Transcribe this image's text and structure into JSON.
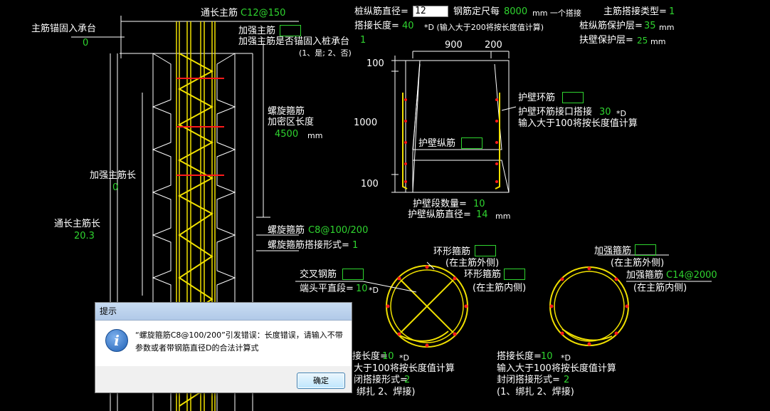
{
  "header": {
    "pile_bar_dia_label": "桩纵筋直径=",
    "pile_bar_dia_value": "12",
    "fixed_length_label": "钢筋定尺每",
    "fixed_length_value": "8000",
    "fixed_length_unit": "mm 一个搭接",
    "main_lap_type_label": "主筋搭接类型=",
    "main_lap_type_value": "1",
    "lap_length_label": "搭接长度=",
    "lap_length_value": "40",
    "lap_length_note": "*D (输入大于200将按长度值计算)",
    "pile_cover_label": "桩纵筋保护层=",
    "pile_cover_value": "35",
    "pile_cover_unit": "mm",
    "wall_cover_label": "扶壁保护层=",
    "wall_cover_value": "25",
    "wall_cover_unit": "mm"
  },
  "left": {
    "through_main_label": "通长主筋",
    "through_main_value": "C12@150",
    "anchor_label": "主筋锚固入承台",
    "anchor_value": "0",
    "extra_main_label": "加强主筋",
    "extra_anchor_label": "加强主筋是否锚固入桩承台",
    "extra_anchor_value": "1",
    "extra_anchor_options": "(1、是; 2、否)",
    "spiral_label": "螺旋箍筋",
    "spiral_dense_label": "加密区长度",
    "spiral_dense_value": "4500",
    "spiral_dense_unit": "mm",
    "extra_main_len_label": "加强主筋长",
    "extra_main_len_value": "0",
    "through_main_len_label": "通长主筋长",
    "through_main_len_value": "20.3",
    "spiral_stirrup_label": "螺旋箍筋",
    "spiral_stirrup_value": "C8@100/200",
    "spiral_lap_label": "螺旋箍筋搭接形式=",
    "spiral_lap_value": "1"
  },
  "wall": {
    "dim_900": "900",
    "dim_200": "200",
    "dim_100_top": "100",
    "dim_1000": "1000",
    "dim_100_bottom": "100",
    "ring_label": "护壁环筋",
    "ring_lap_label": "护壁环筋接口搭接",
    "ring_lap_value": "30",
    "ring_lap_unit": "*D",
    "ring_lap_note": "输入大于100将按长度值计算",
    "long_bar_label": "护壁纵筋",
    "segment_count_label": "护壁段数量=",
    "segment_count_value": "10",
    "long_bar_dia_label": "护壁纵筋直径=",
    "long_bar_dia_value": "14",
    "long_bar_dia_unit": "mm"
  },
  "section1": {
    "ring_outer_label": "环形箍筋",
    "ring_outer_pos": "(在主筋外侧)",
    "cross_label": "交叉钢筋",
    "ring_inner_label": "环形箍筋",
    "end_straight_label": "端头平直段=",
    "end_straight_value": "10",
    "end_straight_unit": "*D",
    "ring_inner_pos": "(在主筋内侧)",
    "lap_len_label": "接长度=",
    "lap_len_value": "10",
    "lap_len_unit": "*D",
    "lap_len_note": "大于100将按长度值计算",
    "closed_lap_label": "闭搭接形式=",
    "closed_lap_value": "2",
    "closed_lap_options": "绑扎  2、焊接)"
  },
  "section2": {
    "add_stirrup_label": "加强箍筋",
    "add_outer_pos": "(在主筋外侧)",
    "add_stirrup_label2": "加强箍筋",
    "add_stirrup_value": "C14@2000",
    "add_inner_pos": "(在主筋内侧)",
    "lap_len_label": "搭接长度=",
    "lap_len_value": "10",
    "lap_len_unit": "*D",
    "lap_len_note": "输入大于100将按长度值计算",
    "closed_lap_label": "封闭搭接形式=",
    "closed_lap_value": "2",
    "closed_lap_options": "(1、绑扎  2、焊接)"
  },
  "dialog": {
    "title": "提示",
    "icon": "i",
    "message": "“螺旋箍筋C8@100/200”引发错误：长度错误，请输入不带参数或者带钢筋直径D的合法计算式",
    "ok_label": "确定"
  },
  "colors": {
    "background": "#000000",
    "green": "#2fd42f",
    "yellow": "#f0e000",
    "red": "#ff1a1a",
    "white": "#ffffff"
  }
}
